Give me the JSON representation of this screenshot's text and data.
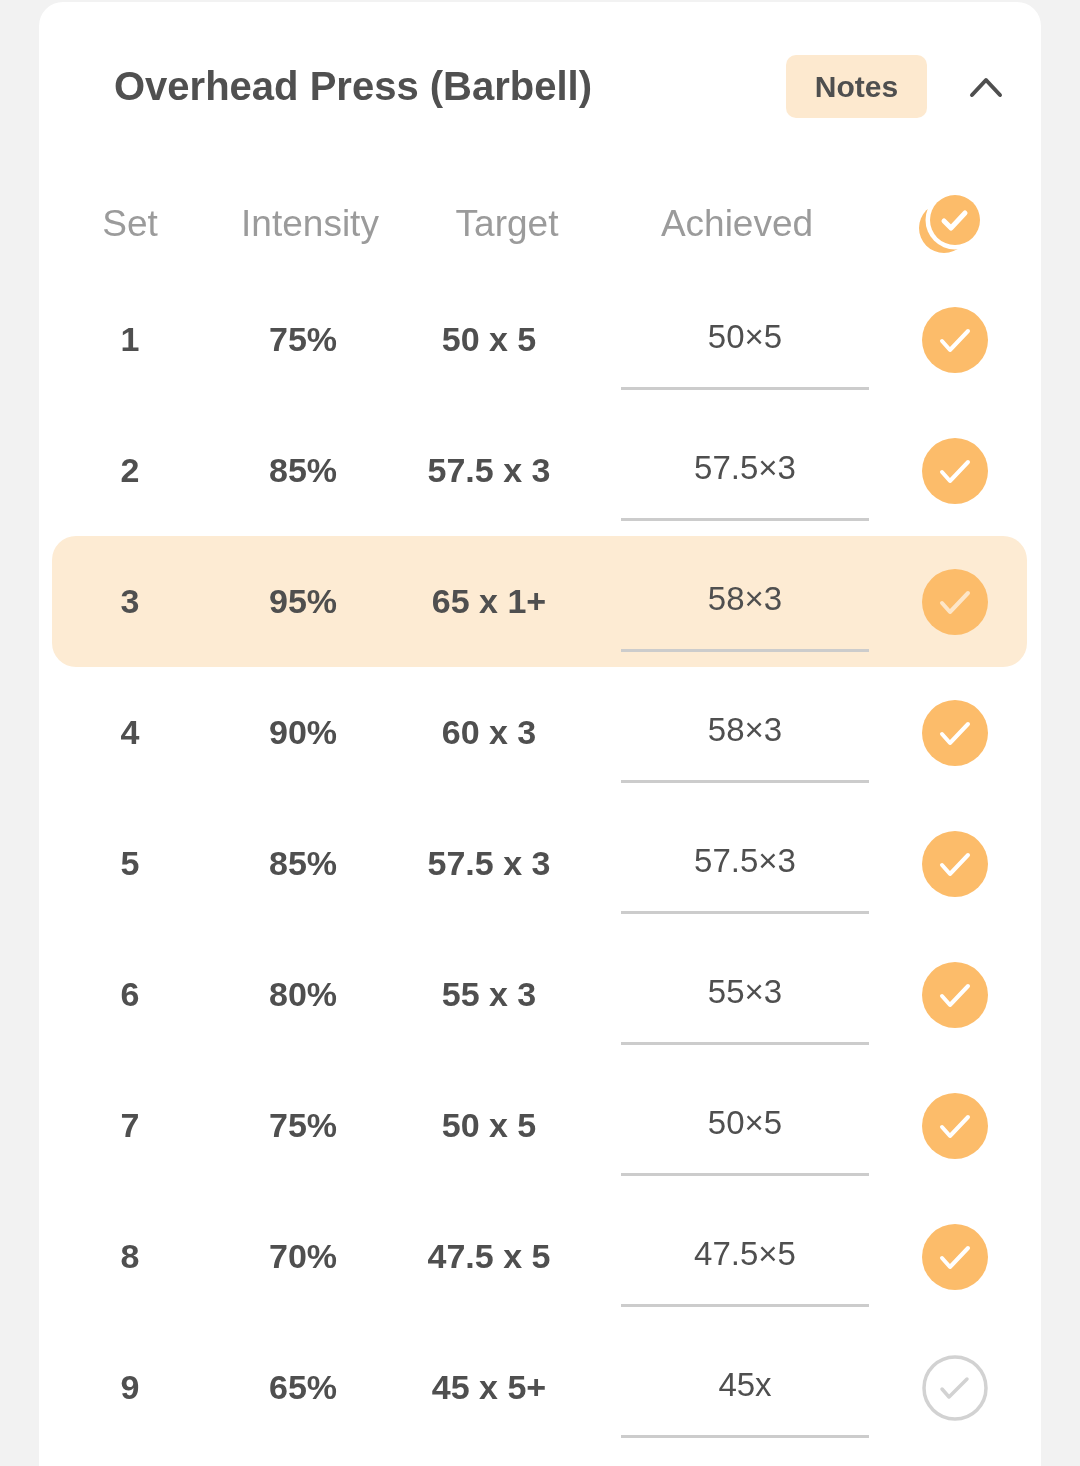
{
  "exercise": {
    "title": "Overhead Press (Barbell)",
    "notes_button": "Notes",
    "expanded": true
  },
  "columns": [
    "Set",
    "Intensity",
    "Target",
    "Achieved"
  ],
  "rows": [
    {
      "set": "1",
      "intensity": "75%",
      "target": "50 x 5",
      "achieved": "50×5",
      "done": true,
      "selected": false
    },
    {
      "set": "2",
      "intensity": "85%",
      "target": "57.5 x 3",
      "achieved": "57.5×3",
      "done": true,
      "selected": false
    },
    {
      "set": "3",
      "intensity": "95%",
      "target": "65 x 1+",
      "achieved": "58×3",
      "done": true,
      "selected": true
    },
    {
      "set": "4",
      "intensity": "90%",
      "target": "60 x 3",
      "achieved": "58×3",
      "done": true,
      "selected": false
    },
    {
      "set": "5",
      "intensity": "85%",
      "target": "57.5 x 3",
      "achieved": "57.5×3",
      "done": true,
      "selected": false
    },
    {
      "set": "6",
      "intensity": "80%",
      "target": "55 x 3",
      "achieved": "55×3",
      "done": true,
      "selected": false
    },
    {
      "set": "7",
      "intensity": "75%",
      "target": "50 x 5",
      "achieved": "50×5",
      "done": true,
      "selected": false
    },
    {
      "set": "8",
      "intensity": "70%",
      "target": "47.5 x 5",
      "achieved": "47.5×5",
      "done": true,
      "selected": false
    },
    {
      "set": "9",
      "intensity": "65%",
      "target": "45 x 5+",
      "achieved": "45x",
      "done": false,
      "selected": false
    }
  ]
}
